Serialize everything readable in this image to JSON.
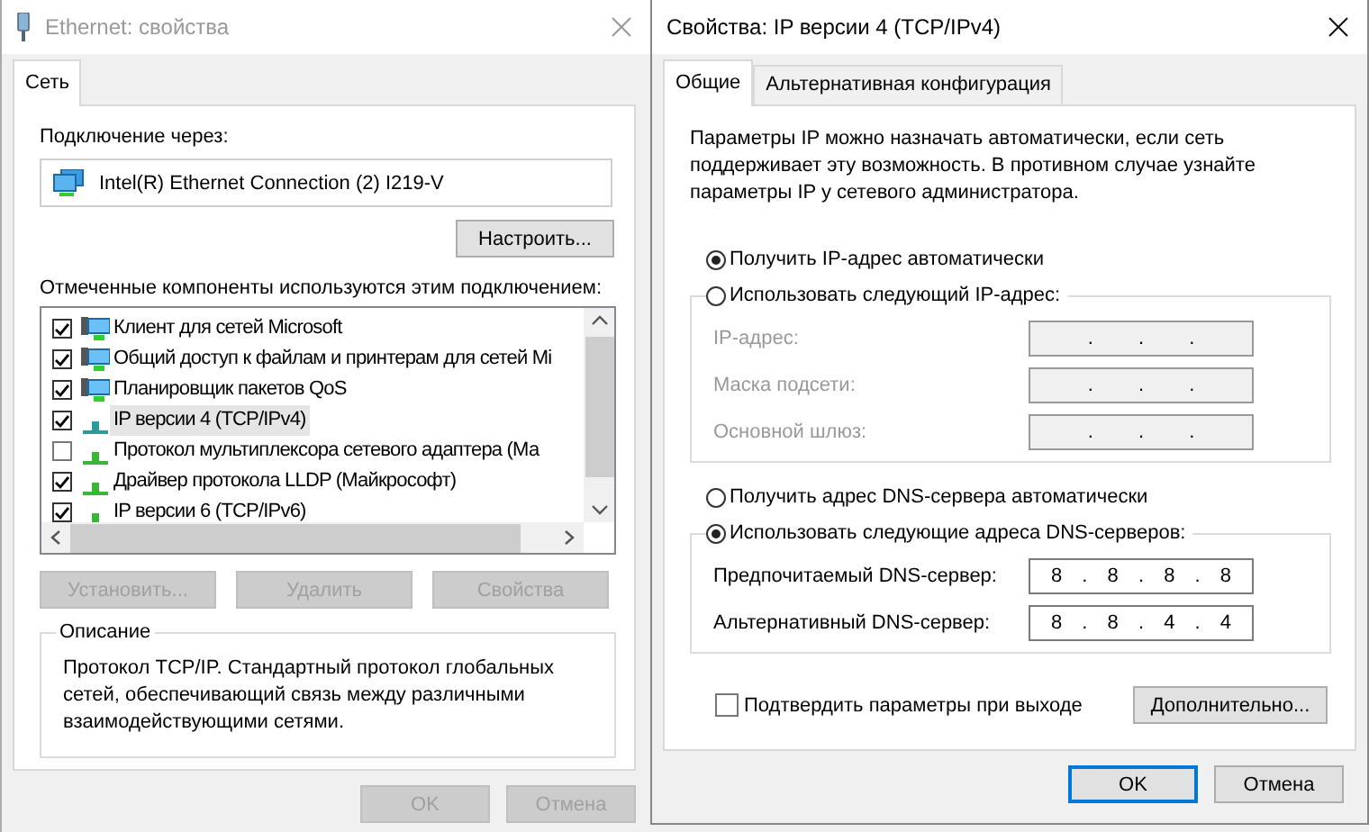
{
  "ethernet_window": {
    "title": "Ethernet: свойства",
    "tabs": [
      {
        "label": "Сеть",
        "selected": true
      }
    ],
    "connect_label": "Подключение через:",
    "adapter": "Intel(R) Ethernet Connection (2) I219-V",
    "configure_button": "Настроить...",
    "components_label": "Отмеченные компоненты используются этим подключением:",
    "components": [
      {
        "label": "Клиент для сетей Microsoft",
        "checked": true,
        "selected": false,
        "kind": "service"
      },
      {
        "label": "Общий доступ к файлам и принтерам для сетей Mi",
        "checked": true,
        "selected": false,
        "kind": "service"
      },
      {
        "label": "Планировщик пакетов QoS",
        "checked": true,
        "selected": false,
        "kind": "service"
      },
      {
        "label": "IP версии 4 (TCP/IPv4)",
        "checked": true,
        "selected": true,
        "kind": "protocol"
      },
      {
        "label": "Протокол мультиплексора сетевого адаптера (Ма",
        "checked": false,
        "selected": false,
        "kind": "protocol"
      },
      {
        "label": "Драйвер протокола LLDP (Майкрософт)",
        "checked": true,
        "selected": false,
        "kind": "protocol"
      },
      {
        "label": "IP версии 6 (TCP/IPv6)",
        "checked": true,
        "selected": false,
        "kind": "protocol"
      }
    ],
    "component_buttons": [
      {
        "label": "Установить...",
        "disabled": true
      },
      {
        "label": "Удалить",
        "disabled": true
      },
      {
        "label": "Свойства",
        "disabled": true
      }
    ],
    "description": {
      "title": "Описание",
      "text": "Протокол TCP/IP. Стандартный протокол глобальных сетей, обеспечивающий связь между различными взаимодействующими сетями."
    },
    "buttons": [
      {
        "label": "OK",
        "disabled": true,
        "default": false
      },
      {
        "label": "Отмена",
        "disabled": true,
        "default": false
      }
    ]
  },
  "ipv4_window": {
    "title": "Свойства: IP версии 4 (TCP/IPv4)",
    "tabs": [
      {
        "label": "Общие",
        "selected": true
      },
      {
        "label": "Альтернативная конфигурация",
        "selected": false
      }
    ],
    "intro": "Параметры IP можно назначать автоматически, если сеть поддерживает эту возможность. В противном случае узнайте параметры IP у сетевого администратора.",
    "ip_auto": {
      "label": "Получить IP-адрес автоматически",
      "selected": true
    },
    "ip_manual": {
      "label": "Использовать следующий IP-адрес:",
      "selected": false,
      "fields": [
        {
          "label": "IP-адрес:",
          "value": ". . ."
        },
        {
          "label": "Маска подсети:",
          "value": ". . ."
        },
        {
          "label": "Основной шлюз:",
          "value": ". . ."
        }
      ]
    },
    "dns_auto": {
      "label": "Получить адрес DNS-сервера автоматически",
      "selected": false
    },
    "dns_manual": {
      "label": "Использовать следующие адреса DNS-серверов:",
      "selected": true,
      "fields": [
        {
          "label": "Предпочитаемый DNS-сервер:",
          "value": "8 . 8 . 8 . 8"
        },
        {
          "label": "Альтернативный DNS-сервер:",
          "value": "8 . 8 . 4 . 4"
        }
      ]
    },
    "validate": {
      "label": "Подтвердить параметры при выходе",
      "checked": false
    },
    "advanced_button": "Дополнительно...",
    "buttons": [
      {
        "label": "OK",
        "disabled": false,
        "default": true
      },
      {
        "label": "Отмена",
        "disabled": false,
        "default": false
      }
    ]
  }
}
